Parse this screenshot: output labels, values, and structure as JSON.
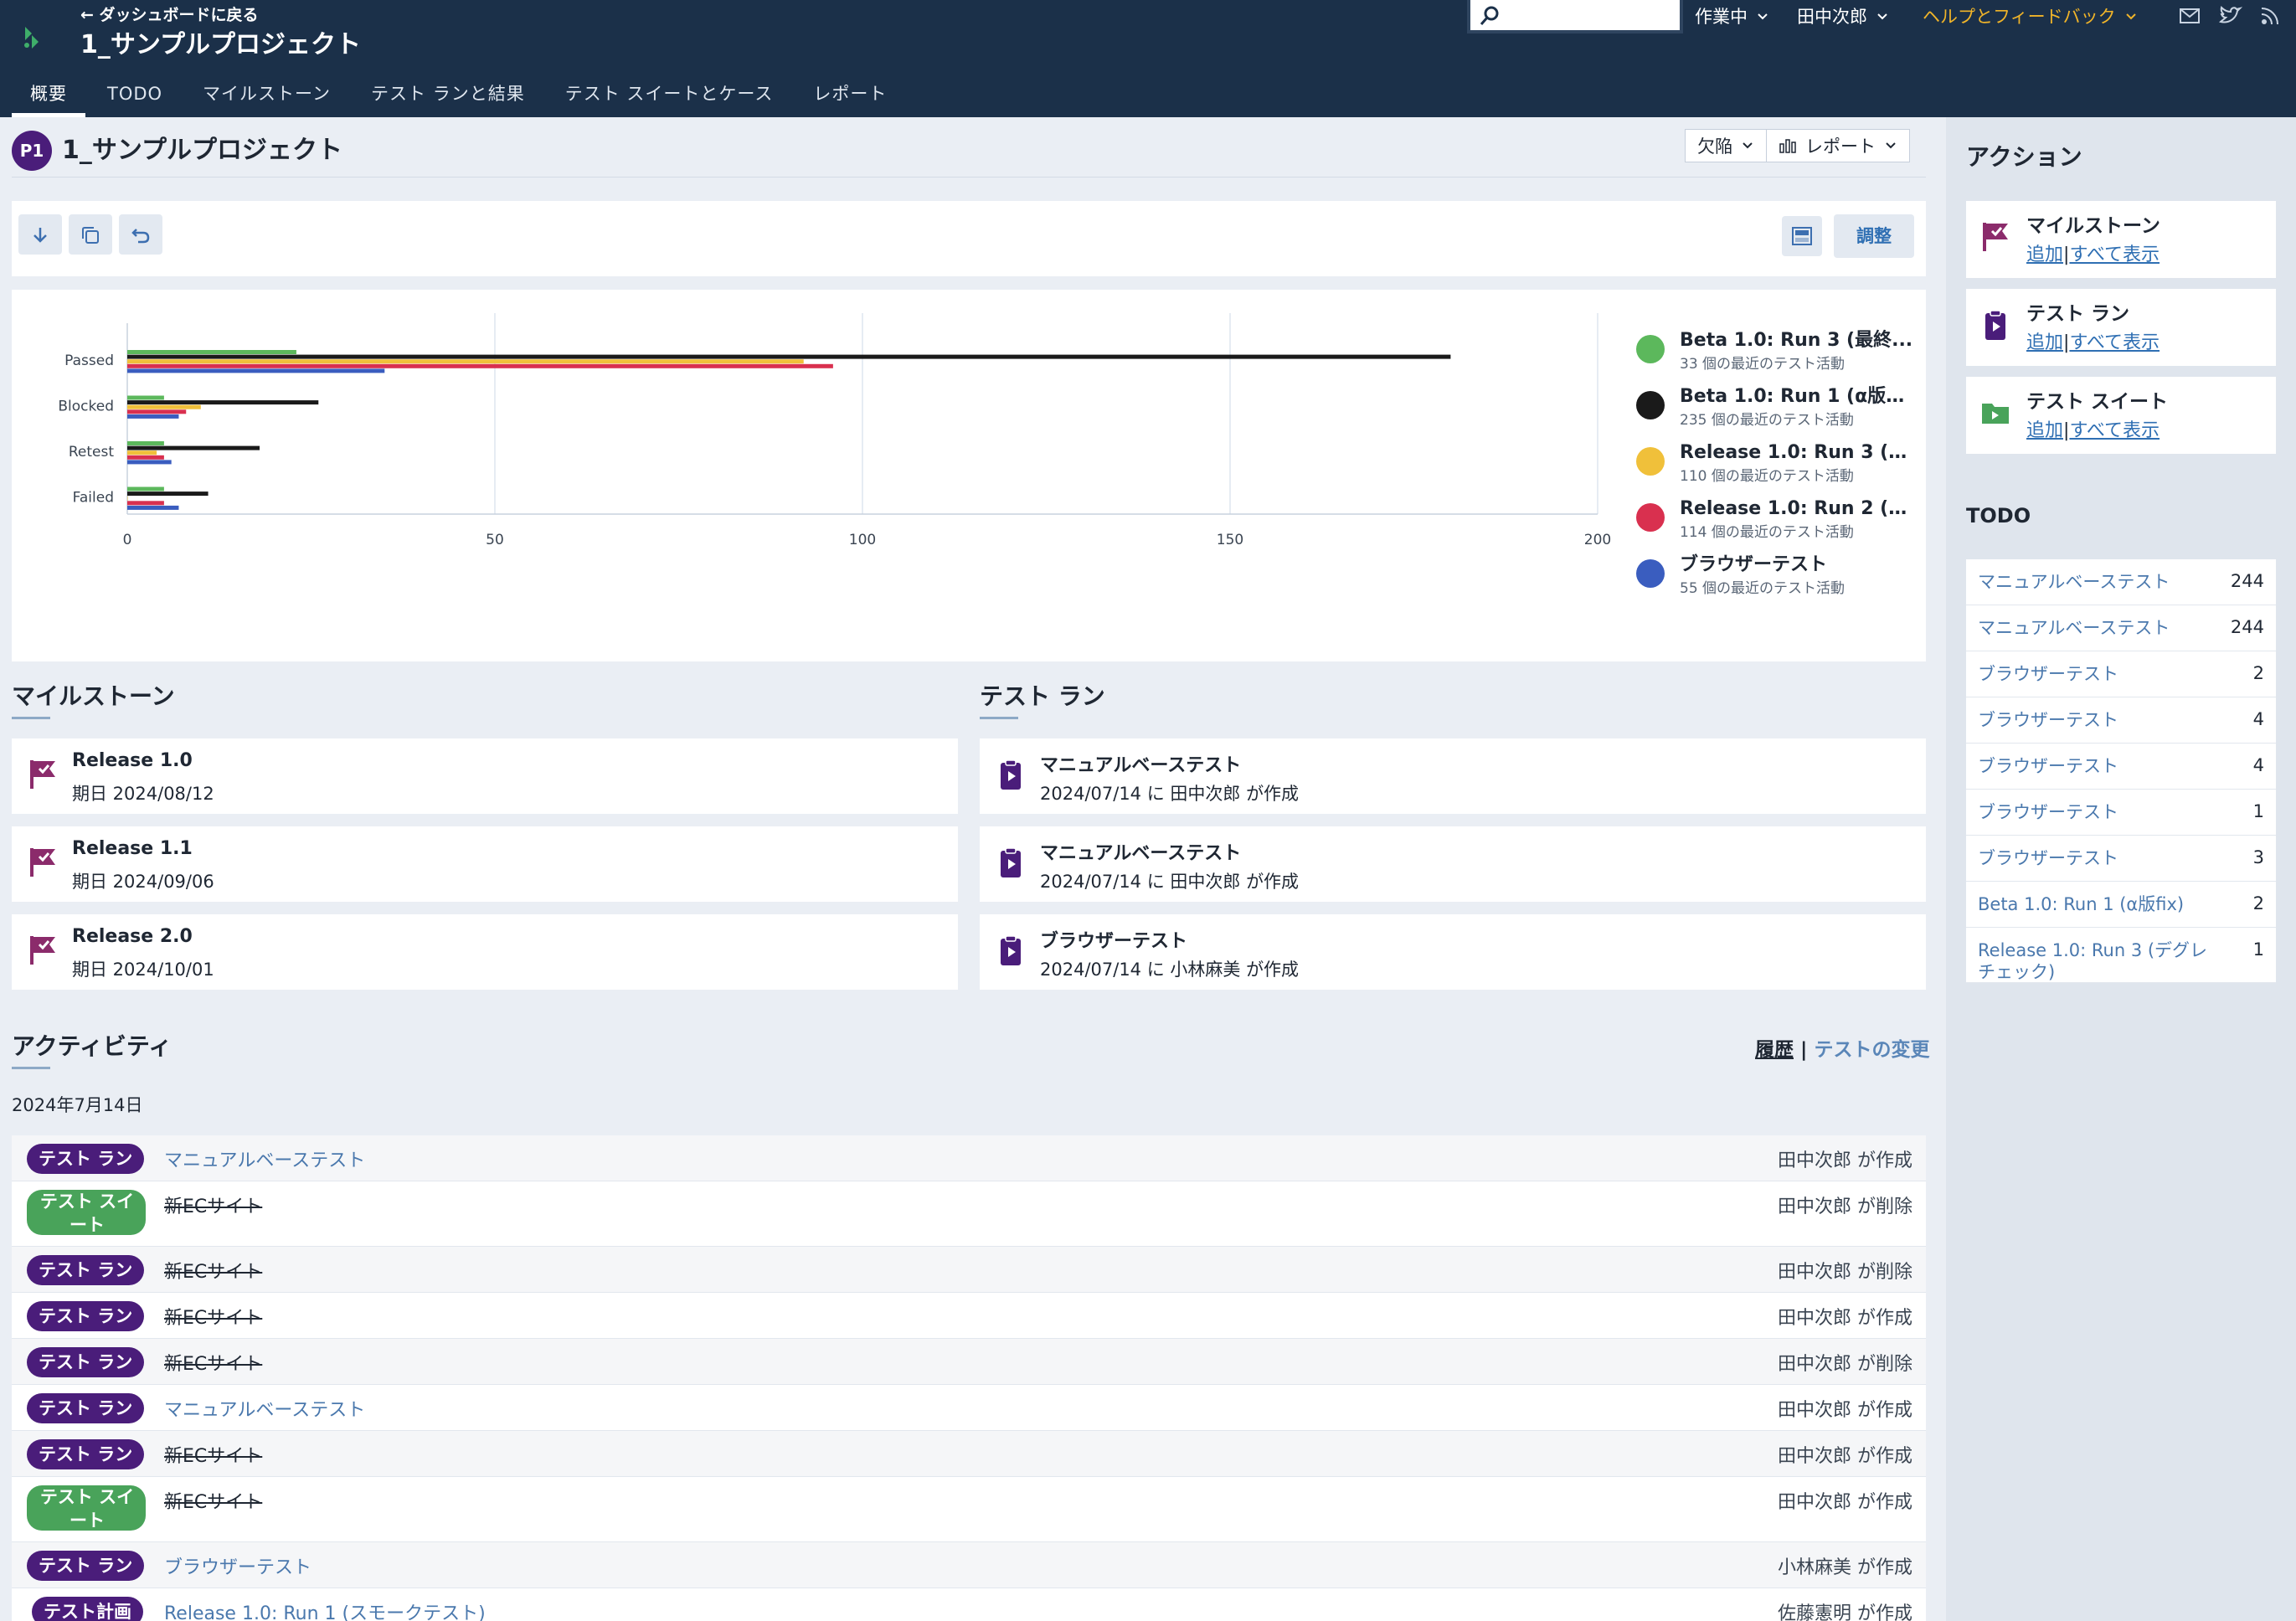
{
  "header": {
    "back_label": "← ダッシュボードに戻る",
    "project_title": "1_サンプルプロジェクト",
    "search_placeholder": "",
    "status_menu": "作業中",
    "user_menu": "田中次郎",
    "help_menu": "ヘルプとフィードバック",
    "icons": [
      "mail-icon",
      "twitter-icon",
      "rss-icon"
    ]
  },
  "nav": {
    "tabs": [
      {
        "label": "概要",
        "active": true
      },
      {
        "label": "TODO"
      },
      {
        "label": "マイルストーン"
      },
      {
        "label": "テスト ランと結果"
      },
      {
        "label": "テスト スイートとケース"
      },
      {
        "label": "レポート"
      }
    ]
  },
  "page": {
    "badge": "P1",
    "title": "1_サンプルプロジェクト",
    "dropdown_defects": "欠陥",
    "dropdown_reports": "レポート",
    "adjust_label": "調整"
  },
  "chart_data": {
    "type": "bar",
    "orientation": "horizontal",
    "categories": [
      "Passed",
      "Blocked",
      "Retest",
      "Failed"
    ],
    "xlim": [
      0,
      200
    ],
    "x_ticks": [
      "0",
      "50",
      "100",
      "150",
      "200"
    ],
    "series": [
      {
        "name": "Beta 1.0: Run 3 (最終...",
        "color": "#5cb85c",
        "values": [
          23,
          5,
          5,
          5
        ]
      },
      {
        "name": "Beta 1.0: Run 1 (α版fix)",
        "color": "#1a1a1a",
        "values": [
          180,
          26,
          18,
          11
        ]
      },
      {
        "name": "Release 1.0: Run 3 (デ...",
        "color": "#f0c03a",
        "values": [
          92,
          10,
          4,
          0
        ]
      },
      {
        "name": "Release 1.0: Run 2 (新...",
        "color": "#d9304f",
        "values": [
          96,
          8,
          5,
          5
        ]
      },
      {
        "name": "ブラウザーテスト",
        "color": "#3a5dbf",
        "values": [
          35,
          7,
          6,
          7
        ]
      }
    ],
    "legend": [
      {
        "name": "Beta 1.0: Run 3 (最終...",
        "sub": "33 個の最近のテスト活動",
        "color": "#5cb85c"
      },
      {
        "name": "Beta 1.0: Run 1 (α版fix)",
        "sub": "235 個の最近のテスト活動",
        "color": "#1a1a1a"
      },
      {
        "name": "Release 1.0: Run 3 (デ...",
        "sub": "110 個の最近のテスト活動",
        "color": "#f0c03a"
      },
      {
        "name": "Release 1.0: Run 2 (新...",
        "sub": "114 個の最近のテスト活動",
        "color": "#d9304f"
      },
      {
        "name": "ブラウザーテスト",
        "sub": "55 個の最近のテスト活動",
        "color": "#3a5dbf"
      }
    ],
    "legend_position": "right",
    "grid": true
  },
  "milestones": {
    "title": "マイルストーン",
    "items": [
      {
        "name": "Release 1.0",
        "due": "期日 2024/08/12"
      },
      {
        "name": "Release 1.1",
        "due": "期日 2024/09/06"
      },
      {
        "name": "Release 2.0",
        "due": "期日 2024/10/01"
      }
    ]
  },
  "test_runs": {
    "title": "テスト ラン",
    "items": [
      {
        "name": "マニュアルベーステスト",
        "meta": "2024/07/14 に 田中次郎 が作成"
      },
      {
        "name": "マニュアルベーステスト",
        "meta": "2024/07/14 に 田中次郎 が作成"
      },
      {
        "name": "ブラウザーテスト",
        "meta": "2024/07/14 に 小林麻美 が作成"
      }
    ]
  },
  "activity": {
    "title": "アクティビティ",
    "link_history": "履歴",
    "link_sep": "|",
    "link_changes": "テストの変更",
    "date": "2024年7月14日",
    "rows": [
      {
        "type": "run",
        "badge": "テスト ラン",
        "name": "マニュアルベーステスト",
        "deleted": false,
        "who": "田中次郎 が作成"
      },
      {
        "type": "suite",
        "badge": "テスト スイート",
        "name": "新ECサイト",
        "deleted": true,
        "who": "田中次郎 が削除"
      },
      {
        "type": "run",
        "badge": "テスト ラン",
        "name": "新ECサイト",
        "deleted": true,
        "who": "田中次郎 が削除"
      },
      {
        "type": "run",
        "badge": "テスト ラン",
        "name": "新ECサイト",
        "deleted": true,
        "who": "田中次郎 が作成"
      },
      {
        "type": "run",
        "badge": "テスト ラン",
        "name": "新ECサイト",
        "deleted": true,
        "who": "田中次郎 が削除"
      },
      {
        "type": "run",
        "badge": "テスト ラン",
        "name": "マニュアルベーステスト",
        "deleted": false,
        "who": "田中次郎 が作成"
      },
      {
        "type": "run",
        "badge": "テスト ラン",
        "name": "新ECサイト",
        "deleted": true,
        "who": "田中次郎 が作成"
      },
      {
        "type": "suite",
        "badge": "テスト スイート",
        "name": "新ECサイト",
        "deleted": true,
        "who": "田中次郎 が作成"
      },
      {
        "type": "run",
        "badge": "テスト ラン",
        "name": "ブラウザーテスト",
        "deleted": false,
        "who": "小林麻美 が作成"
      },
      {
        "type": "plan",
        "badge": "テスト計画",
        "name": "Release 1.0: Run 1 (スモークテスト)",
        "deleted": false,
        "who": "佐藤憲明 が作成"
      }
    ]
  },
  "sidebar": {
    "actions_title": "アクション",
    "actions": [
      {
        "title": "マイルストーン",
        "add": "追加",
        "sep": "|",
        "all": "すべて表示",
        "icon": "milestone-flag-icon"
      },
      {
        "title": "テスト ラン",
        "add": "追加",
        "sep": "|",
        "all": "すべて表示",
        "icon": "test-run-clipboard-icon"
      },
      {
        "title": "テスト スイート",
        "add": "追加",
        "sep": "|",
        "all": "すべて表示",
        "icon": "test-suite-folder-icon"
      }
    ],
    "todo_title": "TODO",
    "todo": [
      {
        "name": "マニュアルベーステスト",
        "count": "244"
      },
      {
        "name": "マニュアルベーステスト",
        "count": "244"
      },
      {
        "name": "ブラウザーテスト",
        "count": "2"
      },
      {
        "name": "ブラウザーテスト",
        "count": "4"
      },
      {
        "name": "ブラウザーテスト",
        "count": "4"
      },
      {
        "name": "ブラウザーテスト",
        "count": "1"
      },
      {
        "name": "ブラウザーテスト",
        "count": "3"
      },
      {
        "name": "Beta 1.0: Run 1 (α版fix)",
        "count": "2"
      },
      {
        "name": "Release 1.0: Run 3 (デグレチェック)",
        "count": "1"
      }
    ]
  }
}
